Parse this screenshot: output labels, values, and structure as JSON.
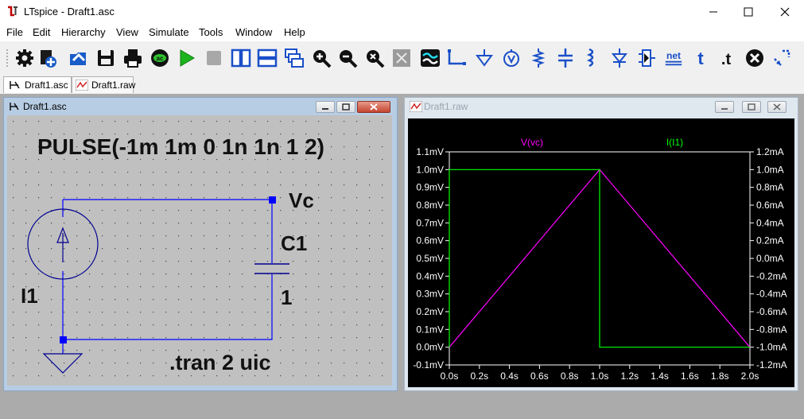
{
  "window": {
    "title": "LTspice - Draft1.asc"
  },
  "menu": [
    "File",
    "Edit",
    "Hierarchy",
    "View",
    "Simulate",
    "Tools",
    "Window",
    "Help"
  ],
  "toolbar": {
    "net_label": "net",
    "t_label": "t",
    "dot_t_label": ".t"
  },
  "tabs": [
    {
      "label": "Draft1.asc",
      "icon": "schematic-icon"
    },
    {
      "label": "Draft1.raw",
      "icon": "waveform-icon"
    }
  ],
  "schematic": {
    "title": "Draft1.asc",
    "pulse_text": "PULSE(-1m 1m 0 1n 1n 1 2)",
    "source_name": "I1",
    "node_label": "Vc",
    "cap_name": "C1",
    "cap_value": "1",
    "directive": ".tran 2 uic",
    "colors": {
      "wire": "#0000ff",
      "background": "#c0c0c0",
      "component": "#000090"
    }
  },
  "waveform": {
    "title": "Draft1.raw",
    "colors": {
      "background": "#000000",
      "trace_vc": "#ff00ff",
      "trace_i1": "#00ff00",
      "axis": "#ffffff"
    }
  },
  "chart_data": {
    "type": "line",
    "x": [
      0.0,
      1.0,
      1.0,
      2.0
    ],
    "xlim": [
      0.0,
      2.0
    ],
    "xticks": [
      "0.0s",
      "0.2s",
      "0.4s",
      "0.6s",
      "0.8s",
      "1.0s",
      "1.2s",
      "1.4s",
      "1.6s",
      "1.8s",
      "2.0s"
    ],
    "left_axis": {
      "ylim": [
        -0.1,
        1.1
      ],
      "ticks": [
        "1.1mV",
        "1.0mV",
        "0.9mV",
        "0.8mV",
        "0.7mV",
        "0.6mV",
        "0.5mV",
        "0.4mV",
        "0.3mV",
        "0.2mV",
        "0.1mV",
        "0.0mV",
        "-0.1mV"
      ]
    },
    "right_axis": {
      "ylim": [
        -1.2,
        1.2
      ],
      "ticks": [
        "1.2mA",
        "1.0mA",
        "0.8mA",
        "0.6mA",
        "0.4mA",
        "0.2mA",
        "0.0mA",
        "-0.2mA",
        "-0.4mA",
        "-0.6mA",
        "-0.8mA",
        "-1.0mA",
        "-1.2mA"
      ]
    },
    "series": [
      {
        "name": "V(vc)",
        "axis": "left",
        "points": [
          [
            0.0,
            0.0
          ],
          [
            1.0,
            1.0
          ],
          [
            2.0,
            0.0
          ]
        ]
      },
      {
        "name": "I(I1)",
        "axis": "right",
        "points": [
          [
            0.0,
            -1.0
          ],
          [
            0.0,
            1.0
          ],
          [
            1.0,
            1.0
          ],
          [
            1.0,
            -1.0
          ],
          [
            2.0,
            -1.0
          ]
        ]
      }
    ]
  }
}
